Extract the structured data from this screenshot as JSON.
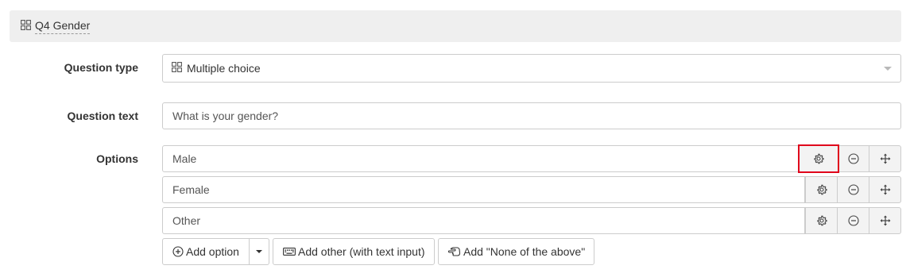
{
  "header": {
    "title": "Q4 Gender"
  },
  "fields": {
    "question_type_label": "Question type",
    "question_type_value": "Multiple choice",
    "question_text_label": "Question text",
    "question_text_value": "What is your gender?",
    "options_label": "Options"
  },
  "options": [
    {
      "value": "Male"
    },
    {
      "value": "Female"
    },
    {
      "value": "Other"
    }
  ],
  "actions": {
    "add_option": "Add option",
    "add_other": "Add other (with text input)",
    "add_none": "Add \"None of the above\""
  },
  "icons": {
    "question_type": "grid-icon",
    "option_settings": "gear-icon",
    "option_remove": "minus-circle-icon",
    "option_move": "move-arrows-icon",
    "add_option": "plus-circle-icon",
    "add_other": "keyboard-icon",
    "add_none": "hand-point-icon"
  },
  "colors": {
    "highlight": "#e0001b",
    "header_bg": "#efefef",
    "button_bg": "#f3f3f3"
  }
}
